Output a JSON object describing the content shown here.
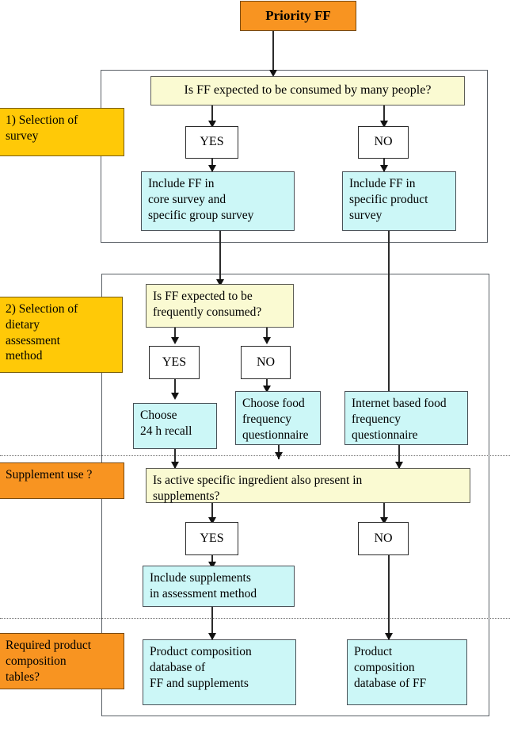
{
  "diagram": {
    "title": "Priority FF",
    "stages": [
      {
        "id": "stage1",
        "label": "1) Selection of\nsurvey"
      },
      {
        "id": "stage2",
        "label": "2) Selection of\ndietary\nassessment\nmethod"
      },
      {
        "id": "stage3",
        "label": "Supplement use ?"
      },
      {
        "id": "stage4",
        "label": "Required product\ncomposition\ntables?"
      }
    ],
    "nodes": {
      "root": "Priority FF",
      "q1": "Is FF expected to be consumed by many people?",
      "q1_yes": "YES",
      "q1_no": "NO",
      "a1_yes": "Include FF in\ncore survey and\nspecific group survey",
      "a1_no": "Include FF in\nspecific product\nsurvey",
      "q2": "Is FF expected to be\nfrequently consumed?",
      "q2_yes": "YES",
      "q2_no": "NO",
      "a2_yes": "Choose\n24 h recall",
      "a2_no": "Choose food\nfrequency\nquestionnaire",
      "a2_internet": "Internet based food\nfrequency\nquestionnaire",
      "q3": "Is active specific ingredient also present in\nsupplements?",
      "q3_yes": "YES",
      "q3_no": "NO",
      "a3_yes": "Include supplements\nin assessment method",
      "a4_left": "Product composition\ndatabase of\nFF and supplements",
      "a4_right": "Product\ncomposition\ndatabase of FF"
    },
    "colors": {
      "root_fill": "#F89421",
      "stage1_fill": "#FFC907",
      "stage2_fill": "#FFC907",
      "stage3_fill": "#F89421",
      "stage4_fill": "#F89421",
      "question_fill": "#FAFAD2",
      "answer_fill": "#CCF7F7",
      "decision_fill": "#FFFFFF",
      "line": "#2b2b2b",
      "frame": "#5a6066"
    }
  }
}
